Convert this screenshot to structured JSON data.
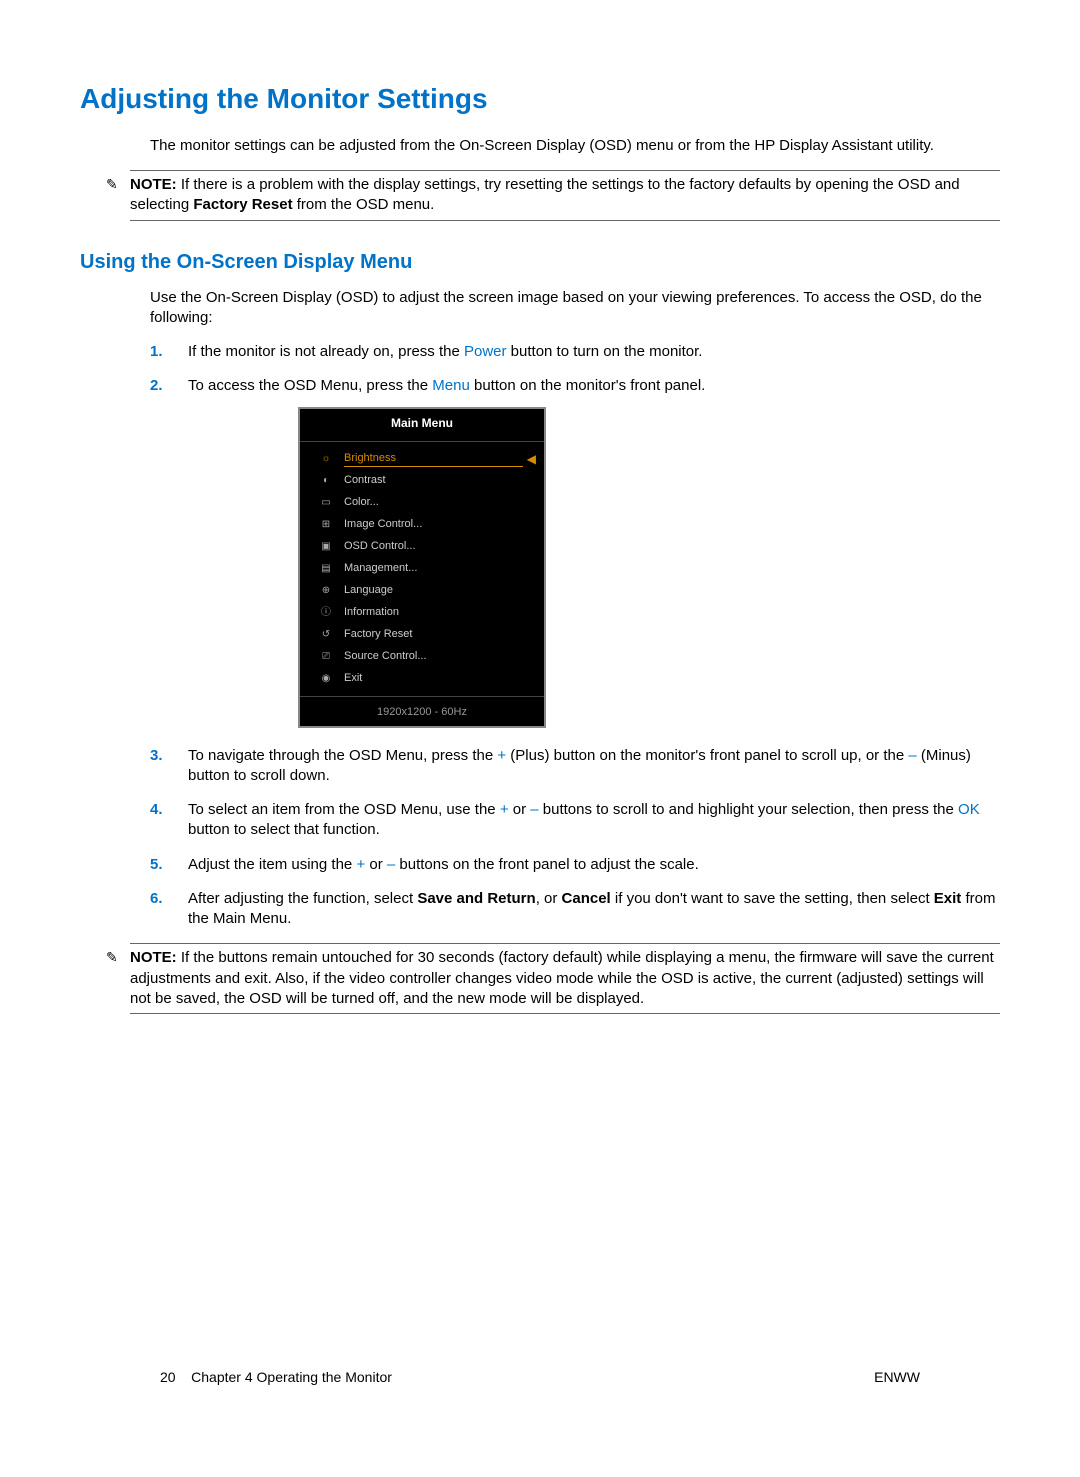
{
  "heading1": "Adjusting the Monitor Settings",
  "intro": "The monitor settings can be adjusted from the On-Screen Display (OSD) menu or from the HP Display Assistant utility.",
  "note1": {
    "label": "NOTE:",
    "text_before": "If there is a problem with the display settings, try resetting the settings to the factory defaults by opening the OSD and selecting ",
    "bold": "Factory Reset",
    "text_after": " from the OSD menu."
  },
  "heading2": "Using the On-Screen Display Menu",
  "para2": "Use the On-Screen Display (OSD) to adjust the screen image based on your viewing preferences. To access the OSD, do the following:",
  "steps": {
    "s1_a": "If the monitor is not already on, press the ",
    "s1_kw": "Power",
    "s1_b": " button to turn on the monitor.",
    "s2_a": "To access the OSD Menu, press the ",
    "s2_kw": "Menu",
    "s2_b": " button on the monitor's front panel.",
    "s3_a": "To navigate through the OSD Menu, press the ",
    "s3_kw1": "+",
    "s3_b": " (Plus) button on the monitor's front panel to scroll up, or the ",
    "s3_kw2": "–",
    "s3_c": " (Minus) button to scroll down.",
    "s4_a": "To select an item from the OSD Menu, use the ",
    "s4_kw1": "+",
    "s4_b": " or ",
    "s4_kw2": "–",
    "s4_c": " buttons to scroll to and highlight your selection, then press the ",
    "s4_kw3": "OK",
    "s4_d": " button to select that function.",
    "s5_a": "Adjust the item using the ",
    "s5_kw1": "+",
    "s5_b": " or ",
    "s5_kw2": "–",
    "s5_c": " buttons on the front panel to adjust the scale.",
    "s6_a": "After adjusting the function, select ",
    "s6_b1": "Save and Return",
    "s6_b": ", or ",
    "s6_b2": "Cancel",
    "s6_c": " if you don't want to save the setting, then select ",
    "s6_b3": "Exit",
    "s6_d": " from the Main Menu."
  },
  "note2": {
    "label": "NOTE:",
    "text": "If the buttons remain untouched for 30 seconds (factory default) while displaying a menu, the firmware will save the current adjustments and exit. Also, if the video controller changes video mode while the OSD is active, the current (adjusted) settings will not be saved, the OSD will be turned off, and the new mode will be displayed."
  },
  "osd": {
    "title": "Main Menu",
    "items": [
      {
        "label": "Brightness",
        "icon": "☼",
        "selected": true
      },
      {
        "label": "Contrast",
        "icon": "◐"
      },
      {
        "label": "Color...",
        "icon": "▭"
      },
      {
        "label": "Image Control...",
        "icon": "⊞"
      },
      {
        "label": "OSD Control...",
        "icon": "▣"
      },
      {
        "label": "Management...",
        "icon": "▤"
      },
      {
        "label": "Language",
        "icon": "⊕"
      },
      {
        "label": "Information",
        "icon": "ⓘ"
      },
      {
        "label": "Factory Reset",
        "icon": "↺"
      },
      {
        "label": "Source Control...",
        "icon": "⎚"
      },
      {
        "label": "Exit",
        "icon": "◉"
      }
    ],
    "footer": "1920x1200 - 60Hz"
  },
  "footer": {
    "page": "20",
    "chapter": "Chapter 4   Operating the Monitor",
    "right": "ENWW"
  }
}
